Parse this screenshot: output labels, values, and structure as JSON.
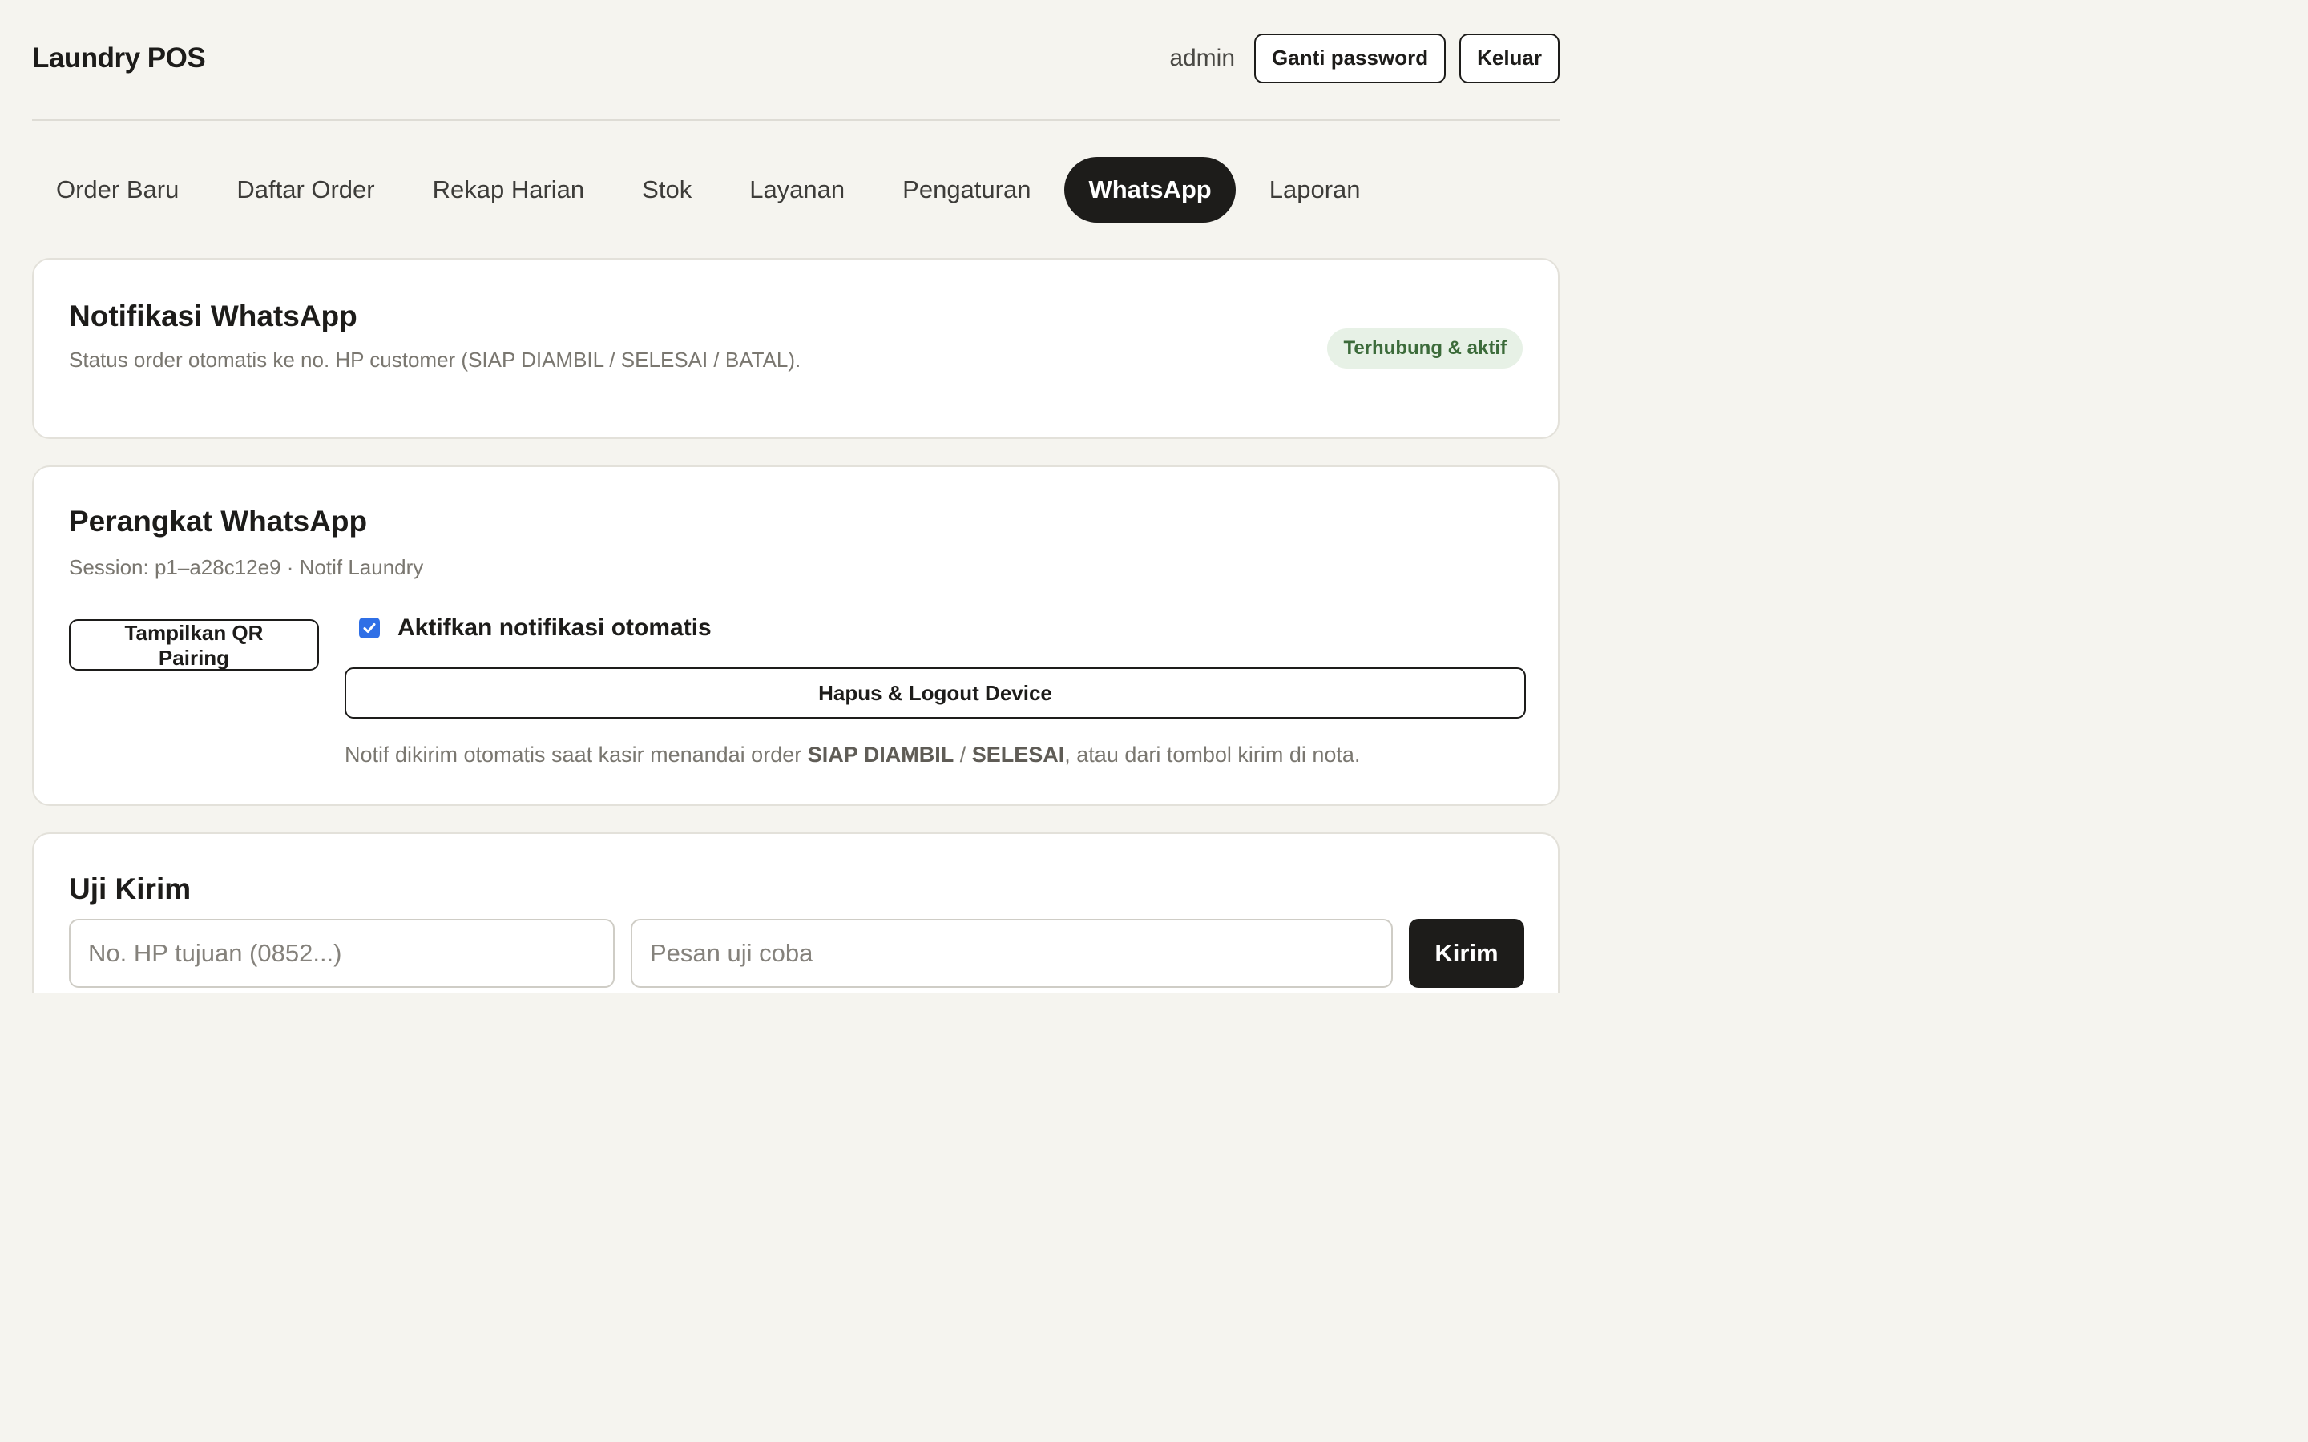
{
  "app": {
    "title": "Laundry POS"
  },
  "header": {
    "user": "admin",
    "change_password_label": "Ganti password",
    "logout_label": "Keluar"
  },
  "nav": {
    "items": [
      {
        "label": "Order Baru",
        "active": false
      },
      {
        "label": "Daftar Order",
        "active": false
      },
      {
        "label": "Rekap Harian",
        "active": false
      },
      {
        "label": "Stok",
        "active": false
      },
      {
        "label": "Layanan",
        "active": false
      },
      {
        "label": "Pengaturan",
        "active": false
      },
      {
        "label": "WhatsApp",
        "active": true
      },
      {
        "label": "Laporan",
        "active": false
      }
    ]
  },
  "notification_card": {
    "title": "Notifikasi WhatsApp",
    "description": "Status order otomatis ke no. HP customer (SIAP DIAMBIL / SELESAI / BATAL).",
    "status_badge": "Terhubung & aktif",
    "status_color": "#3c6b3a"
  },
  "device_card": {
    "title": "Perangkat WhatsApp",
    "session_info": "Session: p1–a28c12e9 · Notif Laundry",
    "qr_button_label": "Tampilkan QR Pairing",
    "auto_notify_label": "Aktifkan notifikasi otomatis",
    "auto_notify_checked": true,
    "logout_device_label": "Hapus & Logout Device",
    "helper_prefix": "Notif dikirim otomatis saat kasir menandai order ",
    "helper_status_1": "SIAP DIAMBIL",
    "helper_separator": " / ",
    "helper_status_2": "SELESAI",
    "helper_suffix": ", atau dari tombol kirim di nota."
  },
  "test_card": {
    "title": "Uji Kirim",
    "phone_value": "",
    "phone_placeholder": "No. HP tujuan (0852...)",
    "message_value": "",
    "message_placeholder": "Pesan uji coba",
    "send_label": "Kirim"
  },
  "colors": {
    "background": "#f5f4ef",
    "accent_dark": "#1d1c1a",
    "checkbox_blue": "#2f6fe6"
  }
}
